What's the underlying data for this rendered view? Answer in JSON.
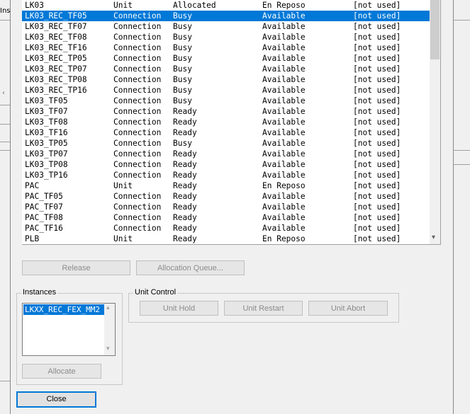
{
  "background": {
    "left_fragment_text": "Ins"
  },
  "units_table": {
    "rows": [
      [
        "LK03",
        "Unit",
        "Allocated",
        "En Reposo",
        "[not used]"
      ],
      [
        "LK03_REC_TF05",
        "Connection",
        "Busy",
        "Available",
        "[not used]"
      ],
      [
        "LK03_REC_TF07",
        "Connection",
        "Busy",
        "Available",
        "[not used]"
      ],
      [
        "LK03_REC_TF08",
        "Connection",
        "Busy",
        "Available",
        "[not used]"
      ],
      [
        "LK03_REC_TF16",
        "Connection",
        "Busy",
        "Available",
        "[not used]"
      ],
      [
        "LK03_REC_TP05",
        "Connection",
        "Busy",
        "Available",
        "[not used]"
      ],
      [
        "LK03_REC_TP07",
        "Connection",
        "Busy",
        "Available",
        "[not used]"
      ],
      [
        "LK03_REC_TP08",
        "Connection",
        "Busy",
        "Available",
        "[not used]"
      ],
      [
        "LK03_REC_TP16",
        "Connection",
        "Busy",
        "Available",
        "[not used]"
      ],
      [
        "LK03_TF05",
        "Connection",
        "Busy",
        "Available",
        "[not used]"
      ],
      [
        "LK03_TF07",
        "Connection",
        "Ready",
        "Available",
        "[not used]"
      ],
      [
        "LK03_TF08",
        "Connection",
        "Ready",
        "Available",
        "[not used]"
      ],
      [
        "LK03_TF16",
        "Connection",
        "Ready",
        "Available",
        "[not used]"
      ],
      [
        "LK03_TP05",
        "Connection",
        "Busy",
        "Available",
        "[not used]"
      ],
      [
        "LK03_TP07",
        "Connection",
        "Ready",
        "Available",
        "[not used]"
      ],
      [
        "LK03_TP08",
        "Connection",
        "Ready",
        "Available",
        "[not used]"
      ],
      [
        "LK03_TP16",
        "Connection",
        "Ready",
        "Available",
        "[not used]"
      ],
      [
        "PAC",
        "Unit",
        "Ready",
        "En Reposo",
        "[not used]"
      ],
      [
        "PAC_TF05",
        "Connection",
        "Ready",
        "Available",
        "[not used]"
      ],
      [
        "PAC_TF07",
        "Connection",
        "Ready",
        "Available",
        "[not used]"
      ],
      [
        "PAC_TF08",
        "Connection",
        "Ready",
        "Available",
        "[not used]"
      ],
      [
        "PAC_TF16",
        "Connection",
        "Ready",
        "Available",
        "[not used]"
      ],
      [
        "PLB",
        "Unit",
        "Ready",
        "En Reposo",
        "[not used]"
      ]
    ],
    "selected_row": 1,
    "selection_color": "#0078d7"
  },
  "buttons": {
    "release": "Release",
    "allocation_queue": "Allocation Queue...",
    "allocate": "Allocate",
    "unit_hold": "Unit Hold",
    "unit_restart": "Unit Restart",
    "unit_abort": "Unit Abort",
    "close": "Close"
  },
  "instances": {
    "title": "Instances",
    "items": [
      "LKXX_REC_FEX_MM2"
    ]
  },
  "unit_control": {
    "title": "Unit Control"
  },
  "icons": {
    "scroll_down": "▾",
    "scroll_up": "▴",
    "left_chevron": "‹"
  }
}
